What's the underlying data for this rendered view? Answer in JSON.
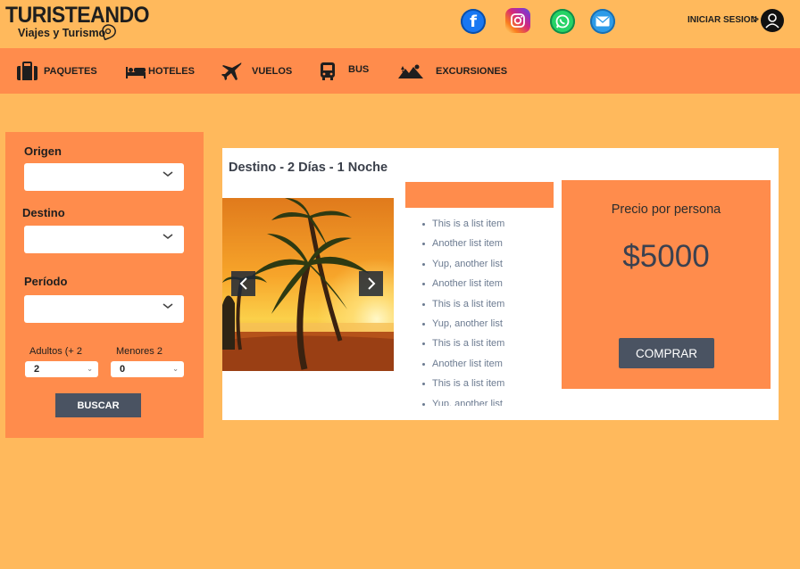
{
  "header": {
    "brand": "TURISTEANDO",
    "tagline": "Viajes y Turismo",
    "login_label": "INICIAR SESION",
    "login_arrow": ">",
    "social": [
      "facebook-icon",
      "instagram-icon",
      "whatsapp-icon",
      "mail-icon"
    ]
  },
  "nav": {
    "items": [
      {
        "label": "PAQUETES",
        "icon": "suitcase-icon"
      },
      {
        "label": "HOTELES",
        "icon": "bed-icon"
      },
      {
        "label": "VUELOS",
        "icon": "airplane-icon"
      },
      {
        "label": "BUS",
        "icon": "bus-icon"
      },
      {
        "label": "EXCURSIONES",
        "icon": "mountain-icon"
      }
    ]
  },
  "search": {
    "origen_label": "Origen",
    "destino_label": "Destino",
    "periodo_label": "Período",
    "adultos_label": "Adultos (+ 2",
    "menores_label": "Menores 2",
    "adultos_value": "2",
    "menores_value": "0",
    "button_label": "BUSCAR"
  },
  "package": {
    "title": "Destino - 2 Días - 1 Noche",
    "list": [
      "This is a list item",
      "Another list item",
      "Yup, another list",
      "Another list item",
      "This is a list item",
      "Yup, another list",
      "This is a list item",
      "Another list item",
      "This is a list item",
      "Yup, another list"
    ],
    "price_label": "Precio por persona",
    "price_value": "$5000",
    "buy_label": "COMPRAR"
  },
  "colors": {
    "background": "#ffb95c",
    "accent": "#ff8c4c",
    "button": "#4a5362"
  }
}
